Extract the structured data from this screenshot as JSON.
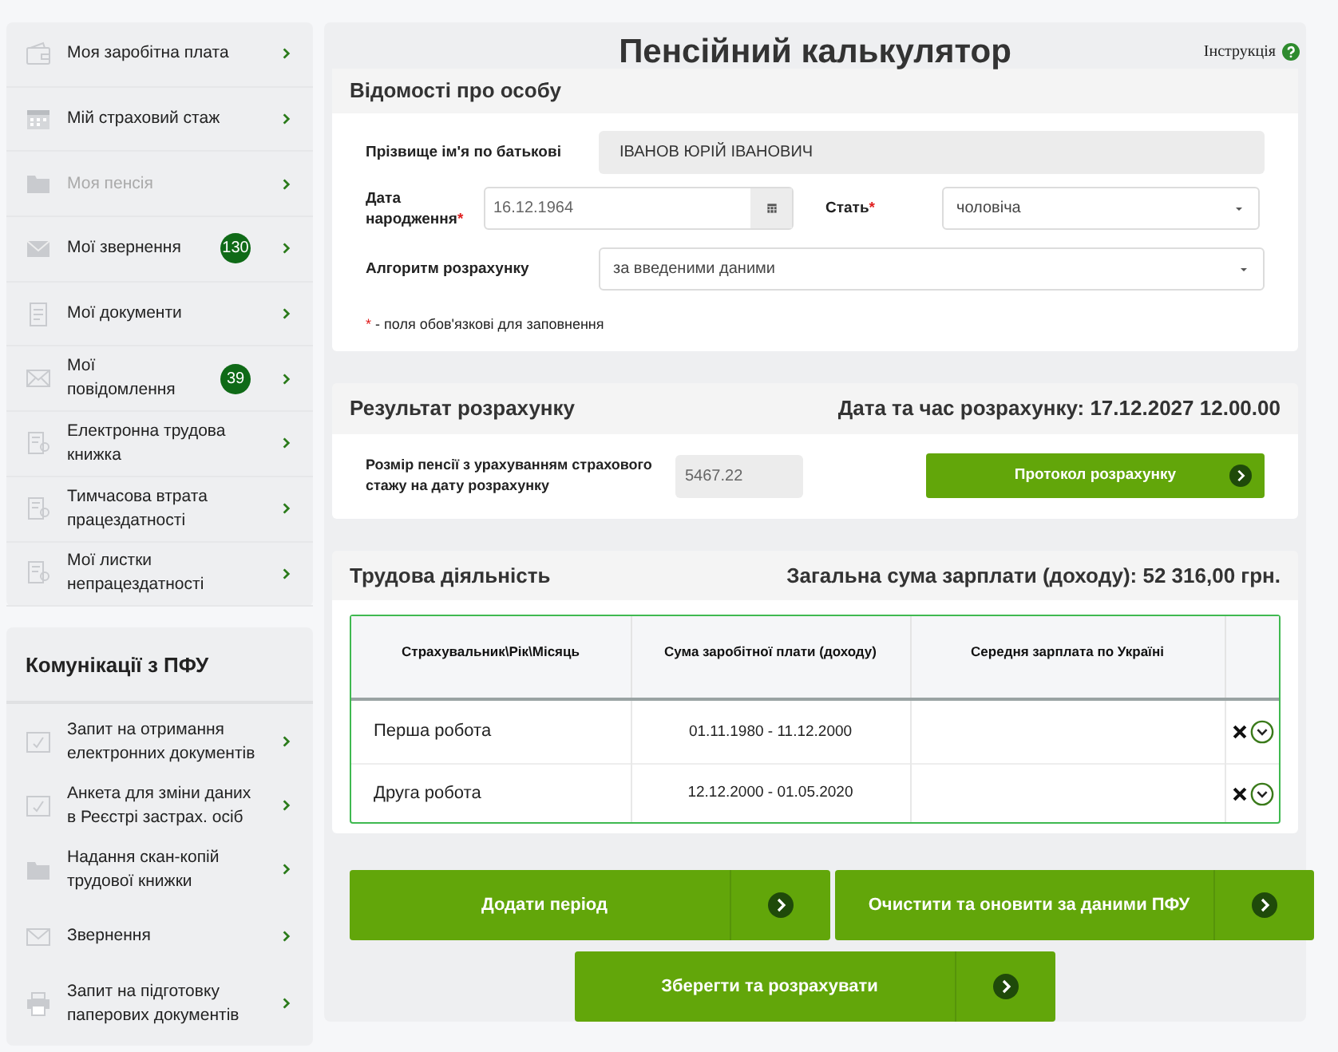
{
  "sidebar": {
    "items": [
      {
        "label": "Моя заробітна плата",
        "disabled": false
      },
      {
        "label": "Мій страховий стаж",
        "disabled": false
      },
      {
        "label": "Моя пенсія",
        "disabled": true
      },
      {
        "label": "Мої звернення",
        "badge": "130",
        "disabled": false
      },
      {
        "label": "Мої документи",
        "disabled": false
      },
      {
        "label": "Мої повідомлення",
        "badge": "39",
        "disabled": false
      },
      {
        "label": "Електронна трудова книжка",
        "disabled": false
      },
      {
        "label": "Тимчасова втрата працездатності",
        "disabled": false
      },
      {
        "label": "Мої листки непрацездатності",
        "disabled": false
      }
    ]
  },
  "communications": {
    "title": "Комунікації з ПФУ",
    "items": [
      {
        "label": "Запит на отримання електронних документів"
      },
      {
        "label": "Анкета для зміни даних в Реєстрі застрах. осіб"
      },
      {
        "label": "Надання скан-копій трудової книжки"
      },
      {
        "label": "Звернення"
      },
      {
        "label": "Запит на підготовку паперових документів"
      }
    ]
  },
  "page": {
    "title": "Пенсійний калькулятор",
    "help_link": "Інструкція"
  },
  "personal_info": {
    "title": "Відомості про особу",
    "full_name": {
      "label": "Прізвище ім'я по батькові",
      "value": "ІВАНОВ ЮРІЙ ІВАНОВИЧ"
    },
    "birth_date": {
      "label": "Дата народження",
      "required_mark": "*",
      "value": "16.12.1964"
    },
    "sex": {
      "label": "Стать",
      "required_mark": "*",
      "value": "чоловіча"
    },
    "algorithm": {
      "label": "Алгоритм розрахунку",
      "value": "за введеними даними"
    },
    "required_note": {
      "mark": "*",
      "text": "- поля обов'язкові для заповнення"
    }
  },
  "result": {
    "title": "Результат розрахунку",
    "timestamp": "Дата та час розрахунку: 17.12.2027 12.00.00",
    "pension_label": "Розмір пенсії з урахуванням страхового стажу на дату розрахунку",
    "pension_value": "5467.22",
    "protocol_button": "Протокол розрахунку"
  },
  "employment": {
    "title": "Трудова діяльність",
    "total": "Загальна сума зарплати (доходу): 52 316,00 грн.",
    "table": {
      "columns": [
        "Страхувальник\\Рік\\Місяць",
        "Сума заробітної плати (доходу)",
        "Середня зарплата по Україні"
      ],
      "rows": [
        {
          "employer": "Перша робота",
          "period": "01.11.1980 - 11.12.2000"
        },
        {
          "employer": "Друга робота",
          "period": "12.12.2000 - 01.05.2020"
        }
      ]
    }
  },
  "buttons": [
    "Додати період",
    "Очистити та оновити за даними ПФУ",
    "Зберегти та розрахувати"
  ]
}
